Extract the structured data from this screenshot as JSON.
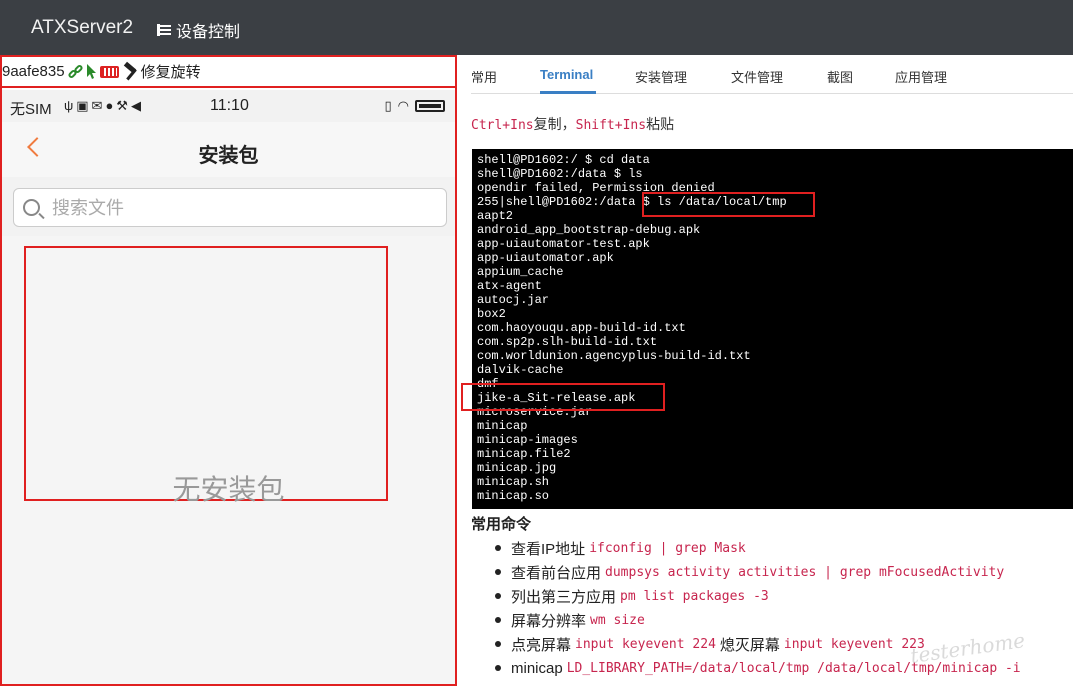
{
  "navbar": {
    "brand": "ATXServer2",
    "device_control_label": "设备控制"
  },
  "device_bar": {
    "serial": "9aafe835",
    "fix_rotation_label": "修复旋转"
  },
  "phone": {
    "status": {
      "carrier": "无SIM",
      "time": "11:10"
    },
    "title": "安装包",
    "search_placeholder": "搜索文件",
    "empty_text": "无安装包"
  },
  "tabs": [
    {
      "label": "常用",
      "active": false
    },
    {
      "label": "Terminal",
      "active": true
    },
    {
      "label": "安装管理",
      "active": false
    },
    {
      "label": "文件管理",
      "active": false
    },
    {
      "label": "截图",
      "active": false
    },
    {
      "label": "应用管理",
      "active": false
    }
  ],
  "hint": {
    "copy_key": "Ctrl+Ins",
    "copy_text": "复制，",
    "paste_key": "Shift+Ins",
    "paste_text": "粘贴"
  },
  "terminal_lines": [
    "shell@PD1602:/ $ cd data",
    "shell@PD1602:/data $ ls",
    "opendir failed, Permission denied",
    "255|shell@PD1602:/data $ ls /data/local/tmp",
    "aapt2",
    "android_app_bootstrap-debug.apk",
    "app-uiautomator-test.apk",
    "app-uiautomator.apk",
    "appium_cache",
    "atx-agent",
    "autocj.jar",
    "box2",
    "com.haoyouqu.app-build-id.txt",
    "com.sp2p.slh-build-id.txt",
    "com.worldunion.agencyplus-build-id.txt",
    "dalvik-cache",
    "dmf",
    "jike-a_Sit-release.apk",
    "microservice.jar",
    "minicap",
    "minicap-images",
    "minicap.file2",
    "minicap.jpg",
    "minicap.sh",
    "minicap.so"
  ],
  "commands": {
    "title": "常用命令",
    "items": [
      {
        "label": "查看IP地址",
        "code": "ifconfig | grep Mask"
      },
      {
        "label": "查看前台应用",
        "code": "dumpsys activity activities | grep mFocusedActivity"
      },
      {
        "label": "列出第三方应用",
        "code": "pm list packages -3"
      },
      {
        "label": "屏幕分辨率",
        "code": "wm size"
      },
      {
        "label": "点亮屏幕",
        "code": "input keyevent 224",
        "label2": "熄灭屏幕",
        "code2": "input keyevent 223"
      },
      {
        "label": "minicap",
        "code": "LD_LIBRARY_PATH=/data/local/tmp /data/local/tmp/minicap -i"
      }
    ]
  },
  "watermark": "testerhome"
}
